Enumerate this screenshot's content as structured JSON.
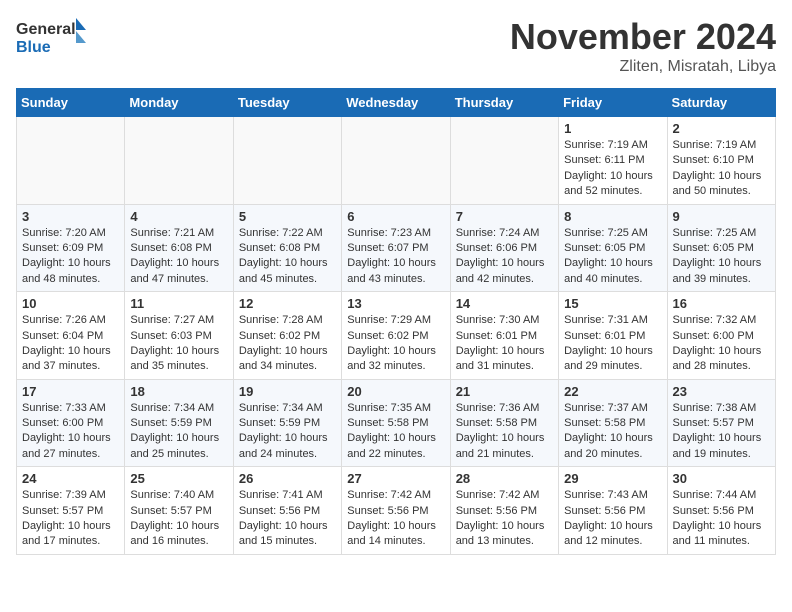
{
  "header": {
    "logo_line1": "General",
    "logo_line2": "Blue",
    "month": "November 2024",
    "location": "Zliten, Misratah, Libya"
  },
  "weekdays": [
    "Sunday",
    "Monday",
    "Tuesday",
    "Wednesday",
    "Thursday",
    "Friday",
    "Saturday"
  ],
  "weeks": [
    [
      {
        "day": "",
        "text": ""
      },
      {
        "day": "",
        "text": ""
      },
      {
        "day": "",
        "text": ""
      },
      {
        "day": "",
        "text": ""
      },
      {
        "day": "",
        "text": ""
      },
      {
        "day": "1",
        "text": "Sunrise: 7:19 AM\nSunset: 6:11 PM\nDaylight: 10 hours and 52 minutes."
      },
      {
        "day": "2",
        "text": "Sunrise: 7:19 AM\nSunset: 6:10 PM\nDaylight: 10 hours and 50 minutes."
      }
    ],
    [
      {
        "day": "3",
        "text": "Sunrise: 7:20 AM\nSunset: 6:09 PM\nDaylight: 10 hours and 48 minutes."
      },
      {
        "day": "4",
        "text": "Sunrise: 7:21 AM\nSunset: 6:08 PM\nDaylight: 10 hours and 47 minutes."
      },
      {
        "day": "5",
        "text": "Sunrise: 7:22 AM\nSunset: 6:08 PM\nDaylight: 10 hours and 45 minutes."
      },
      {
        "day": "6",
        "text": "Sunrise: 7:23 AM\nSunset: 6:07 PM\nDaylight: 10 hours and 43 minutes."
      },
      {
        "day": "7",
        "text": "Sunrise: 7:24 AM\nSunset: 6:06 PM\nDaylight: 10 hours and 42 minutes."
      },
      {
        "day": "8",
        "text": "Sunrise: 7:25 AM\nSunset: 6:05 PM\nDaylight: 10 hours and 40 minutes."
      },
      {
        "day": "9",
        "text": "Sunrise: 7:25 AM\nSunset: 6:05 PM\nDaylight: 10 hours and 39 minutes."
      }
    ],
    [
      {
        "day": "10",
        "text": "Sunrise: 7:26 AM\nSunset: 6:04 PM\nDaylight: 10 hours and 37 minutes."
      },
      {
        "day": "11",
        "text": "Sunrise: 7:27 AM\nSunset: 6:03 PM\nDaylight: 10 hours and 35 minutes."
      },
      {
        "day": "12",
        "text": "Sunrise: 7:28 AM\nSunset: 6:02 PM\nDaylight: 10 hours and 34 minutes."
      },
      {
        "day": "13",
        "text": "Sunrise: 7:29 AM\nSunset: 6:02 PM\nDaylight: 10 hours and 32 minutes."
      },
      {
        "day": "14",
        "text": "Sunrise: 7:30 AM\nSunset: 6:01 PM\nDaylight: 10 hours and 31 minutes."
      },
      {
        "day": "15",
        "text": "Sunrise: 7:31 AM\nSunset: 6:01 PM\nDaylight: 10 hours and 29 minutes."
      },
      {
        "day": "16",
        "text": "Sunrise: 7:32 AM\nSunset: 6:00 PM\nDaylight: 10 hours and 28 minutes."
      }
    ],
    [
      {
        "day": "17",
        "text": "Sunrise: 7:33 AM\nSunset: 6:00 PM\nDaylight: 10 hours and 27 minutes."
      },
      {
        "day": "18",
        "text": "Sunrise: 7:34 AM\nSunset: 5:59 PM\nDaylight: 10 hours and 25 minutes."
      },
      {
        "day": "19",
        "text": "Sunrise: 7:34 AM\nSunset: 5:59 PM\nDaylight: 10 hours and 24 minutes."
      },
      {
        "day": "20",
        "text": "Sunrise: 7:35 AM\nSunset: 5:58 PM\nDaylight: 10 hours and 22 minutes."
      },
      {
        "day": "21",
        "text": "Sunrise: 7:36 AM\nSunset: 5:58 PM\nDaylight: 10 hours and 21 minutes."
      },
      {
        "day": "22",
        "text": "Sunrise: 7:37 AM\nSunset: 5:58 PM\nDaylight: 10 hours and 20 minutes."
      },
      {
        "day": "23",
        "text": "Sunrise: 7:38 AM\nSunset: 5:57 PM\nDaylight: 10 hours and 19 minutes."
      }
    ],
    [
      {
        "day": "24",
        "text": "Sunrise: 7:39 AM\nSunset: 5:57 PM\nDaylight: 10 hours and 17 minutes."
      },
      {
        "day": "25",
        "text": "Sunrise: 7:40 AM\nSunset: 5:57 PM\nDaylight: 10 hours and 16 minutes."
      },
      {
        "day": "26",
        "text": "Sunrise: 7:41 AM\nSunset: 5:56 PM\nDaylight: 10 hours and 15 minutes."
      },
      {
        "day": "27",
        "text": "Sunrise: 7:42 AM\nSunset: 5:56 PM\nDaylight: 10 hours and 14 minutes."
      },
      {
        "day": "28",
        "text": "Sunrise: 7:42 AM\nSunset: 5:56 PM\nDaylight: 10 hours and 13 minutes."
      },
      {
        "day": "29",
        "text": "Sunrise: 7:43 AM\nSunset: 5:56 PM\nDaylight: 10 hours and 12 minutes."
      },
      {
        "day": "30",
        "text": "Sunrise: 7:44 AM\nSunset: 5:56 PM\nDaylight: 10 hours and 11 minutes."
      }
    ]
  ]
}
